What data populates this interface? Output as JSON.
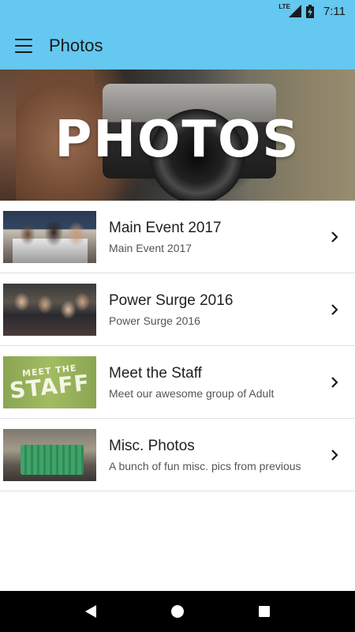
{
  "status_bar": {
    "network": "LTE",
    "time": "7:11",
    "icons": [
      "signal-icon",
      "battery-charging-icon"
    ]
  },
  "app_bar": {
    "title": "Photos",
    "menu_icon": "hamburger-menu-icon"
  },
  "hero": {
    "title": "PHOTOS"
  },
  "albums": [
    {
      "title": "Main Event 2017",
      "subtitle": "Main Event 2017",
      "thumbnail": "group-photo-main-event"
    },
    {
      "title": "Power Surge 2016",
      "subtitle": "Power Surge 2016",
      "thumbnail": "crowd-photo-power-surge"
    },
    {
      "title": "Meet the Staff",
      "subtitle": "Meet our awesome group of Adult",
      "thumbnail": "meet-the-staff-graphic",
      "thumbnail_text": [
        "MEET THE",
        "STAFF"
      ]
    },
    {
      "title": "Misc. Photos",
      "subtitle": "A bunch of fun misc. pics from previous",
      "thumbnail": "group-photo-misc"
    }
  ],
  "nav_bar": {
    "icons": [
      "back-icon",
      "home-icon",
      "recents-icon"
    ]
  },
  "colors": {
    "app_bar": "#64c8f0",
    "nav_bar": "#000000",
    "divider": "#dedede"
  }
}
